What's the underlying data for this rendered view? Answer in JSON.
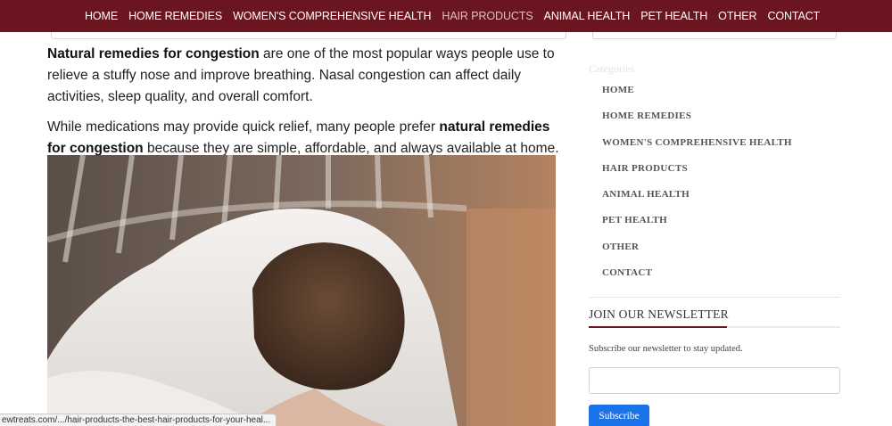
{
  "nav": {
    "items": [
      {
        "label": "HOME"
      },
      {
        "label": "HOME REMEDIES"
      },
      {
        "label": "WOMEN'S COMPREHENSIVE HEALTH"
      },
      {
        "label": "HAIR PRODUCTS"
      },
      {
        "label": "ANIMAL HEALTH"
      },
      {
        "label": "PET HEALTH"
      },
      {
        "label": "OTHER"
      },
      {
        "label": "CONTACT"
      }
    ],
    "active_index": 3
  },
  "article": {
    "p1_bold": "Natural remedies for congestion",
    "p1_rest": " are one of the most popular ways people use to relieve a stuffy nose and improve breathing. Nasal congestion can affect daily activities, sleep quality, and overall comfort.",
    "p2_start": "While medications may provide quick relief, many people prefer ",
    "p2_bold": "natural remedies for congestion",
    "p2_end": " because they are simple, affordable, and always available at home."
  },
  "sidebar": {
    "categories_title": "Categories",
    "categories": [
      "HOME",
      "HOME REMEDIES",
      "WOMEN'S COMPREHENSIVE HEALTH",
      "HAIR PRODUCTS",
      "ANIMAL HEALTH",
      "PET HEALTH",
      "OTHER",
      "CONTACT"
    ],
    "newsletter_title": "JOIN OUR NEWSLETTER",
    "newsletter_desc": "Subscribe our newsletter to stay updated.",
    "subscribe_label": "Subscribe"
  },
  "status_bar": {
    "url": "ewtreats.com/.../hair-products-the-best-hair-products-for-your-heal..."
  },
  "colors": {
    "nav_bg": "#6b1520",
    "accent": "#6b1520",
    "button": "#1a73e8"
  }
}
